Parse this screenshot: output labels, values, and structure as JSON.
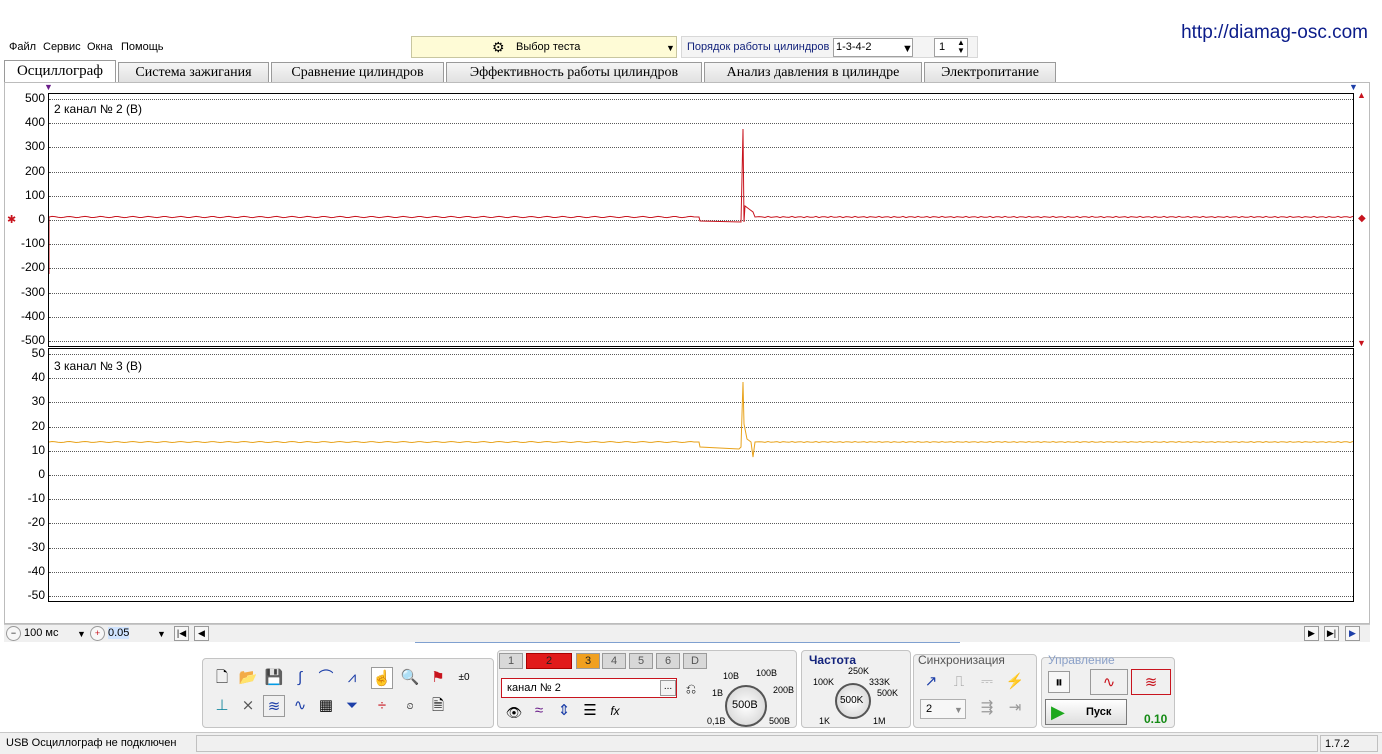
{
  "site_url": "http://diamag-osc.com",
  "menu": [
    "Файл",
    "Сервис",
    "Окна",
    "Помощь"
  ],
  "test_select": {
    "label": "Выбор теста"
  },
  "cylinder_order": {
    "label": "Порядок работы цилиндров",
    "value": "1-3-4-2",
    "spin_value": "1"
  },
  "tabs": [
    "Осциллограф",
    "Система зажигания",
    "Сравнение цилиндров",
    "Эффективность работы цилиндров",
    "Анализ давления в цилиндре",
    "Электропитание"
  ],
  "active_tab": "Осциллограф",
  "channel2": {
    "label": "2  канал № 2 (В)",
    "color": "#c8141e",
    "y_ticks": [
      "500",
      "400",
      "300",
      "200",
      "100",
      "0",
      "-100",
      "-200",
      "-300",
      "-400",
      "-500"
    ]
  },
  "channel3": {
    "label": "3  канал № 3 (В)",
    "color": "#e8a21a",
    "y_ticks": [
      "50",
      "40",
      "30",
      "20",
      "10",
      "0",
      "-10",
      "-20",
      "-30",
      "-40",
      "-50"
    ]
  },
  "timebar": {
    "timebase": "100 мс",
    "offset": "0.05"
  },
  "channels_buttons": [
    "1",
    "2",
    "3",
    "4",
    "5",
    "6",
    "D"
  ],
  "channel_name_field": "канал № 2",
  "channel_name_more": "...",
  "voltage_knob": {
    "value": "500В",
    "labels": [
      "10В",
      "100В",
      "1В",
      "200В",
      "0,1В",
      "500В"
    ]
  },
  "frequency": {
    "title": "Частота",
    "value": "500K",
    "labels": [
      "250K",
      "100K",
      "333K",
      "500K",
      "1K",
      "1M"
    ]
  },
  "sync": {
    "title": "Синхронизация",
    "channel": "2"
  },
  "control": {
    "title": "Управление",
    "start": "Пуск",
    "value": "0.10"
  },
  "status": {
    "message": "USB Осциллограф не подключен",
    "version": "1.7.2"
  },
  "colors": {
    "accent_blue": "#13237c",
    "start_green": "#1ea81e",
    "value_green": "#148a14"
  }
}
